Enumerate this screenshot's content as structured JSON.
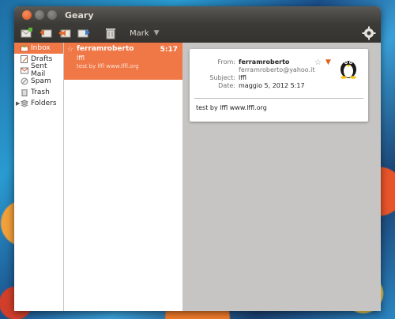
{
  "window": {
    "title": "Geary"
  },
  "toolbar": {
    "icons": [
      "compose-icon",
      "reply-icon",
      "reply-all-icon",
      "forward-icon",
      "delete-icon"
    ],
    "mark_label": "Mark",
    "mark_caret": "▼"
  },
  "sidebar": {
    "items": [
      {
        "label": "Inbox",
        "icon": "inbox-icon",
        "selected": true
      },
      {
        "label": "Drafts",
        "icon": "drafts-icon"
      },
      {
        "label": "Sent Mail",
        "icon": "sent-mail-icon"
      },
      {
        "label": "Spam",
        "icon": "spam-icon"
      },
      {
        "label": "Trash",
        "icon": "trash-icon"
      },
      {
        "label": "Folders",
        "icon": "folders-icon",
        "expander": "▶"
      }
    ]
  },
  "message_list": {
    "items": [
      {
        "from": "ferramroberto",
        "time": "5:17",
        "subject": "lffl",
        "preview": "test by lffl www.lffl.org",
        "star": "☆"
      }
    ]
  },
  "reader": {
    "labels": {
      "from": "From:",
      "subject": "Subject:",
      "date": "Date:"
    },
    "from_name": "ferramroberto",
    "from_email": "ferramroberto@yahoo.it",
    "subject": "lffl",
    "date": "maggio 5, 2012 5:17",
    "body": "test by lffl www.lffl.org",
    "star": "☆",
    "menu": "▼"
  },
  "colors": {
    "accent": "#f07746",
    "titlebar": "#3c3b37",
    "reader_bg": "#c6c5c3"
  }
}
